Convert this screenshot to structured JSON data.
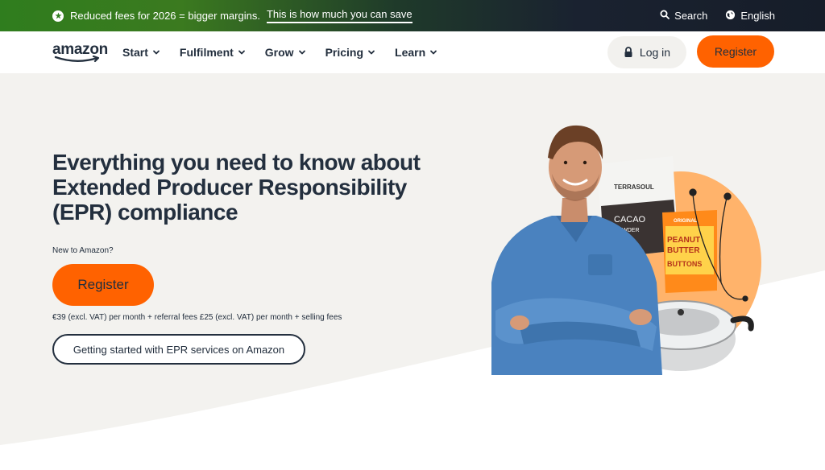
{
  "promo": {
    "text": "Reduced fees for 2026 = bigger margins.",
    "link": "This is how much you can save",
    "search": "Search",
    "language": "English"
  },
  "nav": {
    "logo": "amazon",
    "items": [
      {
        "label": "Start"
      },
      {
        "label": "Fulfilment"
      },
      {
        "label": "Grow"
      },
      {
        "label": "Pricing"
      },
      {
        "label": "Learn"
      }
    ],
    "login": "Log in",
    "register": "Register"
  },
  "hero": {
    "title": "Everything you need to know about Extended Producer Responsibility (EPR) compliance",
    "new_label": "New to Amazon?",
    "register": "Register",
    "fees": "€39 (excl. VAT) per month + referral fees £25 (excl. VAT) per month + selling fees",
    "epr_button": "Getting started with EPR services on Amazon",
    "product1": "TERRASOUL",
    "product1_sub": "CACAO",
    "product1_sub2": "POWDER",
    "product2_tag": "ORIGINAL",
    "product2": "PEANUT",
    "product2_b": "BUTTER",
    "product2_c": "BUTTONS"
  },
  "colors": {
    "accent": "#ff6200",
    "ink": "#232f3e",
    "hero_bg": "#f3f2ef",
    "circle": "#ffb36b"
  }
}
